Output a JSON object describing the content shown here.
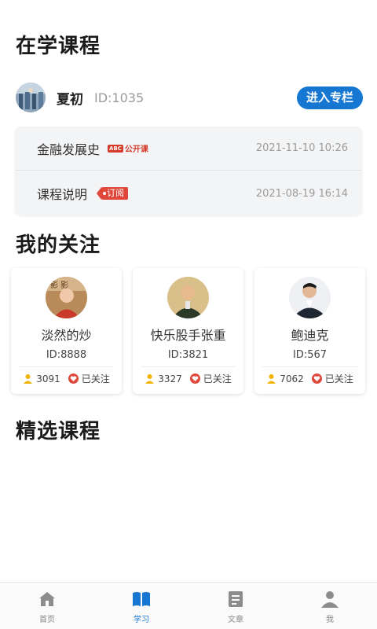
{
  "sections": {
    "studying_title": "在学课程",
    "follow_title": "我的关注",
    "featured_title": "精选课程"
  },
  "teacher": {
    "name": "夏初",
    "id_text": "ID:1035",
    "enter_button": "进入专栏"
  },
  "courses": [
    {
      "name": "金融发展史",
      "tag_abc": "ABC",
      "tag_text": "公开课",
      "date": "2021-11-10 10:26"
    },
    {
      "name": "课程说明",
      "tag_text": "订阅",
      "date": "2021-08-19 16:14"
    }
  ],
  "follows": [
    {
      "name": "淡然的炒",
      "id_text": "ID:8888",
      "count": "3091",
      "status": "已关注"
    },
    {
      "name": "快乐股手张重",
      "id_text": "ID:3821",
      "count": "3327",
      "status": "已关注"
    },
    {
      "name": "鲍迪克",
      "id_text": "ID:567",
      "count": "7062",
      "status": "已关注"
    }
  ],
  "nav": {
    "items": [
      {
        "label": "首页",
        "icon": "home-icon",
        "active": false
      },
      {
        "label": "学习",
        "icon": "book-icon",
        "active": true
      },
      {
        "label": "文章",
        "icon": "article-icon",
        "active": false
      },
      {
        "label": "我",
        "icon": "user-icon",
        "active": false
      }
    ]
  },
  "colors": {
    "accent": "#1677d2",
    "tag_red": "#e0473b",
    "follower_icon": "#f0b400",
    "nav_inactive": "#8c8c8c"
  }
}
